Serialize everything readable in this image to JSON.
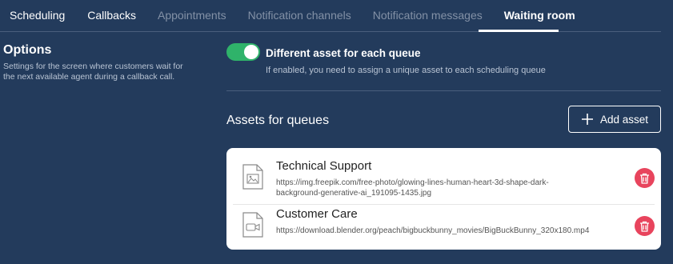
{
  "tabs": [
    {
      "label": "Scheduling",
      "state": "enabled"
    },
    {
      "label": "Callbacks",
      "state": "enabled"
    },
    {
      "label": "Appointments",
      "state": "disabled"
    },
    {
      "label": "Notification channels",
      "state": "disabled"
    },
    {
      "label": "Notification messages",
      "state": "disabled"
    },
    {
      "label": "Waiting room",
      "state": "active"
    }
  ],
  "options": {
    "title": "Options",
    "description": "Settings for the screen where customers wait for the next available agent during a callback call."
  },
  "toggle": {
    "label": "Different asset for each queue",
    "help": "If enabled, you need to assign a unique asset to each scheduling queue",
    "on": true
  },
  "assets": {
    "title": "Assets for queues",
    "add_label": "Add asset",
    "items": [
      {
        "name": "Technical Support",
        "url": "https://img.freepik.com/free-photo/glowing-lines-human-heart-3d-shape-dark-background-generative-ai_191095-1435.jpg",
        "icon": "image-file-icon"
      },
      {
        "name": "Customer Care",
        "url": "https://download.blender.org/peach/bigbuckbunny_movies/BigBuckBunny_320x180.mp4",
        "icon": "video-file-icon"
      }
    ]
  },
  "colors": {
    "background": "#233b5c",
    "toggle_on": "#2fb36a",
    "delete": "#e8445d"
  }
}
